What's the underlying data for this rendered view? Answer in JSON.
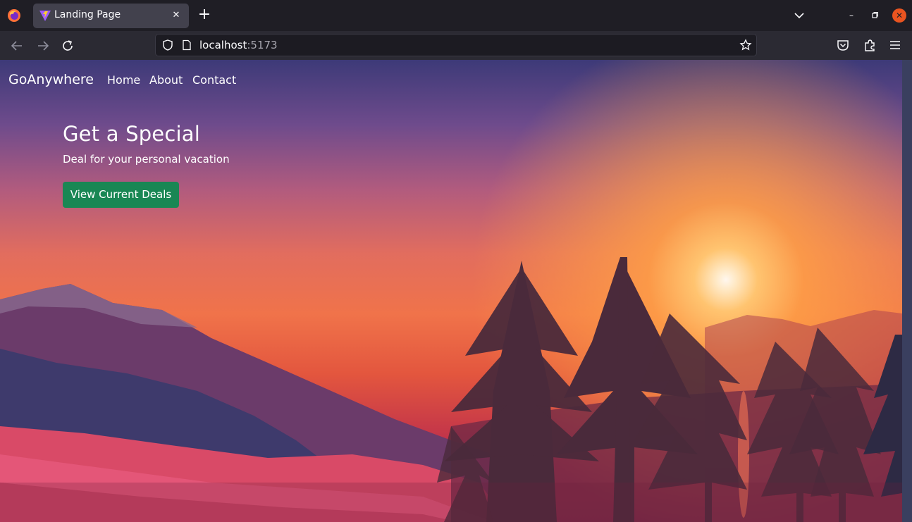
{
  "browser": {
    "tab": {
      "title": "Landing Page"
    },
    "url": {
      "host": "localhost",
      "port": ":5173"
    }
  },
  "site": {
    "brand": "GoAnywhere",
    "nav": {
      "home": "Home",
      "about": "About",
      "contact": "Contact"
    },
    "hero": {
      "title": "Get a Special",
      "subtitle": "Deal for your personal vacation",
      "cta_label": "View Current Deals"
    }
  },
  "colors": {
    "cta": "#198754",
    "close_button": "#e95420"
  }
}
